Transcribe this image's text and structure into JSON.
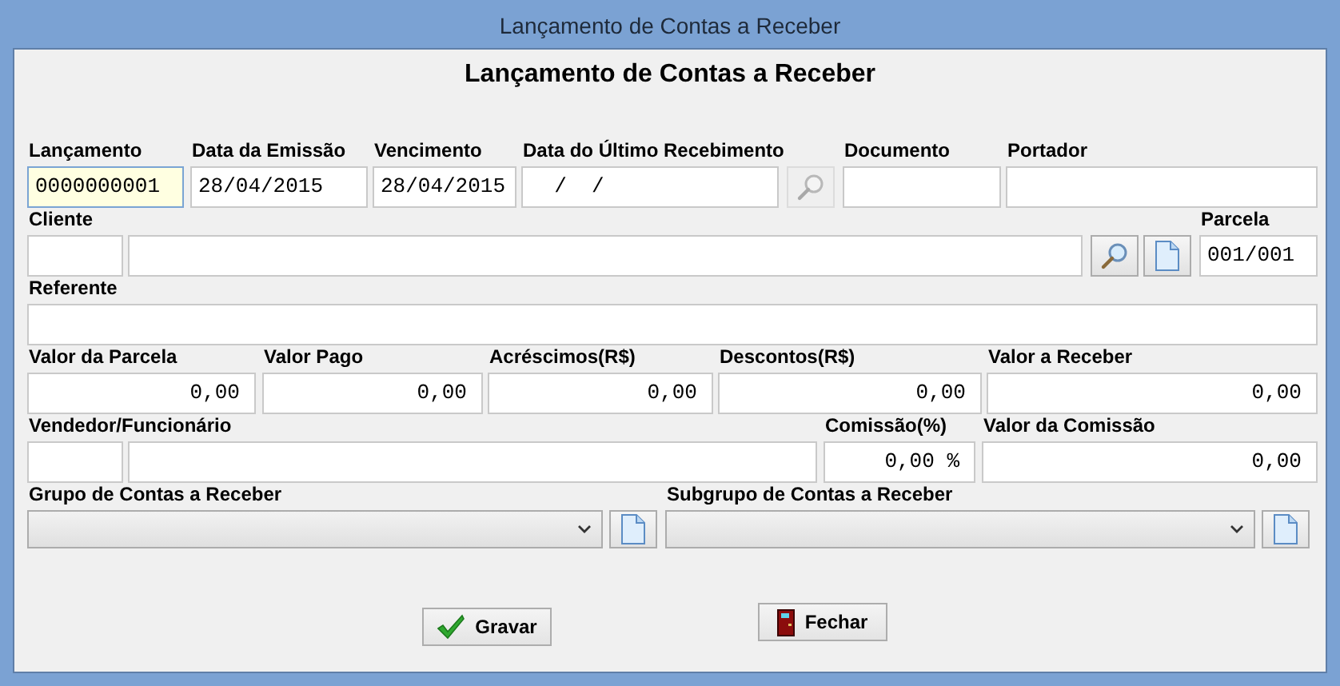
{
  "window": {
    "title": "Lançamento de Contas a Receber"
  },
  "heading": "Lançamento de Contas a Receber",
  "rows": [
    [
      {
        "kind": "text",
        "label": "Lançamento",
        "value": "0000000001",
        "focused": true
      },
      {
        "kind": "text",
        "label": "Data da Emissão",
        "value": "28/04/2015",
        "focused": false
      },
      {
        "kind": "text",
        "label": "Vencimento",
        "value": "28/04/2015",
        "focused": false
      },
      {
        "kind": "text",
        "label": "Data do Último Recebimento",
        "value": "  /  /",
        "focused": false
      },
      {
        "kind": "search_button",
        "disabled": true
      },
      {
        "kind": "text",
        "label": "Documento",
        "focused": false
      },
      {
        "kind": "text",
        "label": "Portador",
        "focused": false
      }
    ],
    [
      {
        "kind": "text",
        "label": "Cliente",
        "focused": false
      },
      {
        "kind": "text",
        "focused": false
      },
      {
        "kind": "search_button",
        "disabled": false
      },
      {
        "kind": "new_button",
        "disabled": false
      },
      {
        "kind": "text",
        "label": "Parcela",
        "value": "001/001",
        "focused": false
      }
    ],
    [
      {
        "kind": "text",
        "label": "Referente",
        "focused": false
      }
    ],
    [
      {
        "kind": "number",
        "label": "Valor da Parcela",
        "value": "0,00",
        "focused": false
      },
      {
        "kind": "number",
        "label": "Valor Pago",
        "value": "0,00",
        "focused": false
      },
      {
        "kind": "number",
        "label": "Acréscimos(R$)",
        "value": "0,00",
        "focused": false
      },
      {
        "kind": "number",
        "label": "Descontos(R$)",
        "value": "0,00",
        "focused": false
      },
      {
        "kind": "number",
        "label": "Valor a Receber",
        "value": "0,00",
        "focused": false
      }
    ],
    [
      {
        "kind": "text",
        "label": "Vendedor/Funcionário",
        "focused": false
      },
      {
        "kind": "text",
        "focused": false
      },
      {
        "kind": "number",
        "label": "Comissão(%)",
        "value": "0,00 %",
        "focused": false
      },
      {
        "kind": "number",
        "label": "Valor da Comissão",
        "value": "0,00",
        "focused": false
      }
    ],
    [
      {
        "kind": "combo",
        "label": "Grupo de Contas a Receber"
      },
      {
        "kind": "new_button",
        "disabled": false
      },
      {
        "kind": "combo",
        "label": "Subgrupo de Contas a Receber"
      },
      {
        "kind": "new_button",
        "disabled": false
      }
    ]
  ],
  "buttons": [
    {
      "kind": "save",
      "label": "Gravar"
    },
    {
      "kind": "close",
      "label": "Fechar"
    }
  ]
}
